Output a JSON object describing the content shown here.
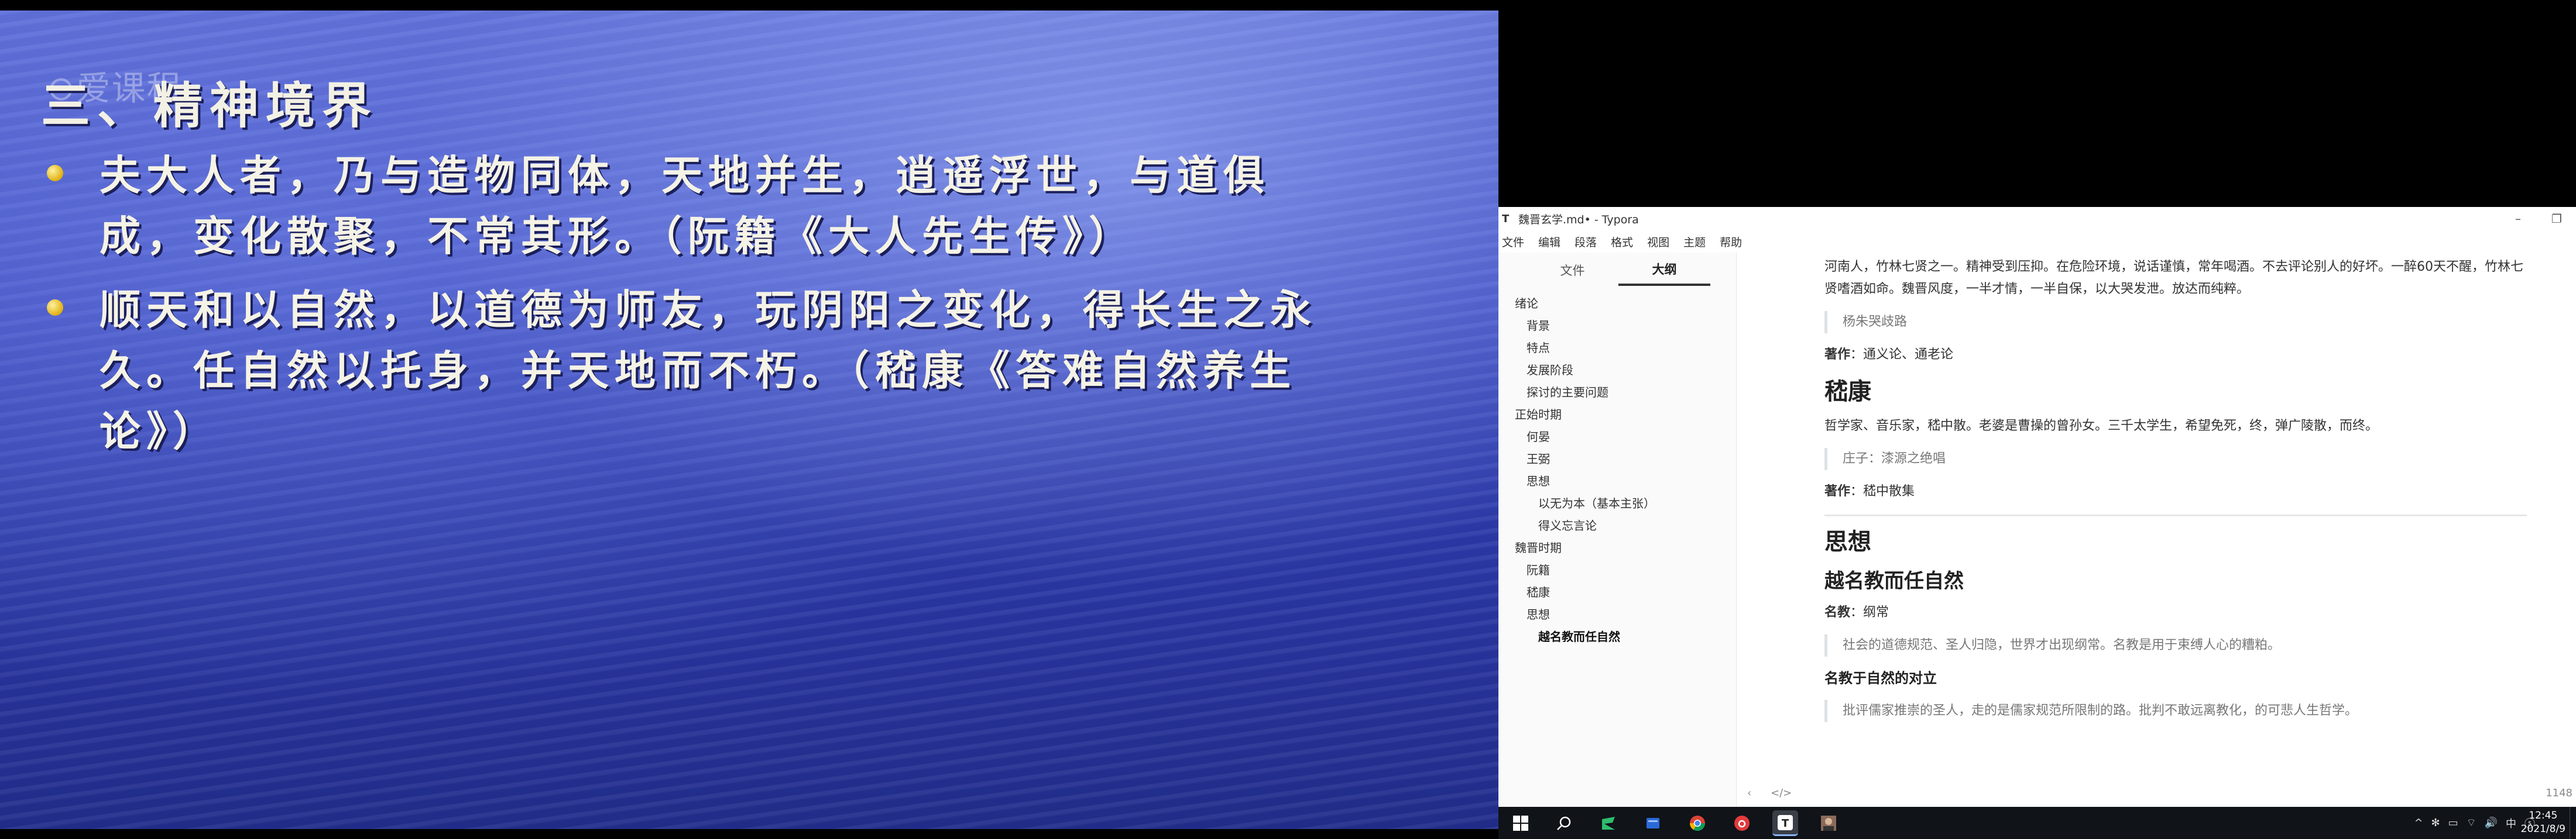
{
  "video": {
    "watermark": "⊙爱课程",
    "title": "三、精神境界",
    "bullets": [
      "夫大人者，乃与造物同体，天地并生，逍遥浮世，与道俱成，变化散聚，不常其形。（阮籍《大人先生传》）",
      "顺天和以自然，以道德为师友，玩阴阳之变化，得长生之永久。任自然以托身，并天地而不朽。（嵇康《答难自然养生论》）"
    ]
  },
  "typora": {
    "window_title": "魏晋玄学.md• - Typora",
    "app_icon": "T",
    "window_controls": {
      "minimize": "–",
      "restore": "❐"
    },
    "menu": [
      "文件",
      "编辑",
      "段落",
      "格式",
      "视图",
      "主题",
      "帮助"
    ],
    "sidebar": {
      "tabs": [
        "文件",
        "大纲"
      ],
      "active_tab": "大纲",
      "outline": [
        {
          "label": "绪论",
          "level": 1
        },
        {
          "label": "背景",
          "level": 2
        },
        {
          "label": "特点",
          "level": 2
        },
        {
          "label": "发展阶段",
          "level": 2
        },
        {
          "label": "探讨的主要问题",
          "level": 2
        },
        {
          "label": "正始时期",
          "level": 1
        },
        {
          "label": "何晏",
          "level": 2
        },
        {
          "label": "王弼",
          "level": 2
        },
        {
          "label": "思想",
          "level": 2
        },
        {
          "label": "以无为本（基本主张）",
          "level": 3
        },
        {
          "label": "得义忘言论",
          "level": 3
        },
        {
          "label": "魏晋时期",
          "level": 1
        },
        {
          "label": "阮籍",
          "level": 2
        },
        {
          "label": "嵇康",
          "level": 2
        },
        {
          "label": "思想",
          "level": 2
        },
        {
          "label": "越名教而任自然",
          "level": 3,
          "active": true
        }
      ]
    },
    "editor": {
      "para1": "河南人，竹林七贤之一。精神受到压抑。在危险环境，说话谨慎，常年喝酒。不去评论别人的好坏。一醉60天不醒，竹林七贤嗜酒如命。魏晋风度，一半才情，一半自保，以大哭发泄。放达而纯粹。",
      "quote1": "杨朱哭歧路",
      "works1_label": "著作",
      "works1_text": "：通义论、通老论",
      "h2_jikang": "嵇康",
      "para2": "哲学家、音乐家，嵇中散。老婆是曹操的曾孙女。三千太学生，希望免死，终，弹广陵散，而终。",
      "quote2": "庄子：漆源之绝唱",
      "works2_label": "著作",
      "works2_text": "：嵇中散集",
      "h2_sixiang": "思想",
      "h3_yue": "越名教而任自然",
      "mingjiao_label": "名教",
      "mingjiao_text": "：纲常",
      "quote3": "社会的道德规范、圣人归隐，世界才出现纲常。名教是用于束缚人心的糟粕。",
      "h4_duili": "名教于自然的对立",
      "quote4": "批评儒家推崇的圣人，走的是儒家规范所限制的路。批判不敢远离教化，的可悲人生哲学。"
    },
    "statusbar": {
      "back": "‹",
      "source": "</>",
      "word_count": "1148"
    }
  },
  "taskbar": {
    "start": "⊞",
    "search": "⌕",
    "tray": [
      "^",
      "✻",
      "▭",
      "⌔",
      "🔊",
      "中",
      "ⓢ"
    ],
    "time": "12:45",
    "date": "2021/8/9"
  },
  "colors": {
    "slide_blue": "#3e4cc4",
    "bullet_gold": "#e0b010",
    "taskbar": "#101318"
  }
}
